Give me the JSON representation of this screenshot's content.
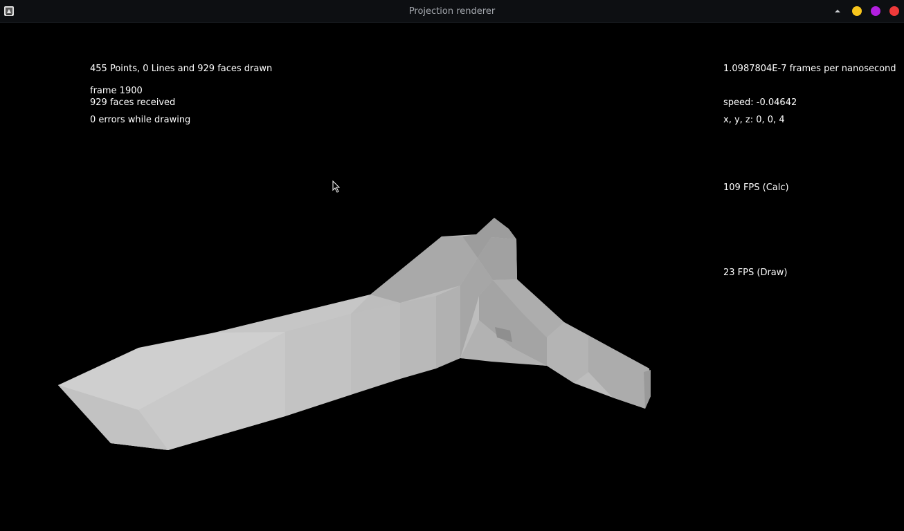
{
  "window": {
    "title": "Projection renderer",
    "colors": {
      "minimize": "#f7c51c",
      "maximize": "#b31fe0",
      "close": "#f03a3a",
      "titlebar": "#0d0f12",
      "title_text": "#a3a7ad",
      "background": "#000000",
      "hud_text": "#ffffff",
      "model": "#c7c7c7"
    },
    "icons": {
      "app": "java-app-icon",
      "menu": "caret-up-icon",
      "cursor": "mouse-pointer-icon"
    }
  },
  "stats_left": {
    "summary": "455 Points, 0 Lines and 929 faces drawn",
    "frame": "frame 1900",
    "faces_received": "929 faces received",
    "errors": "0 errors while drawing"
  },
  "stats_right": {
    "frames_per_ns": "1.0987804E-7 frames per nanosecond",
    "speed": "speed: -0.04642",
    "position": "x, y, z: 0, 0, 4",
    "fps_calc": "109 FPS (Calc)",
    "fps_draw": "23 FPS (Draw)"
  }
}
